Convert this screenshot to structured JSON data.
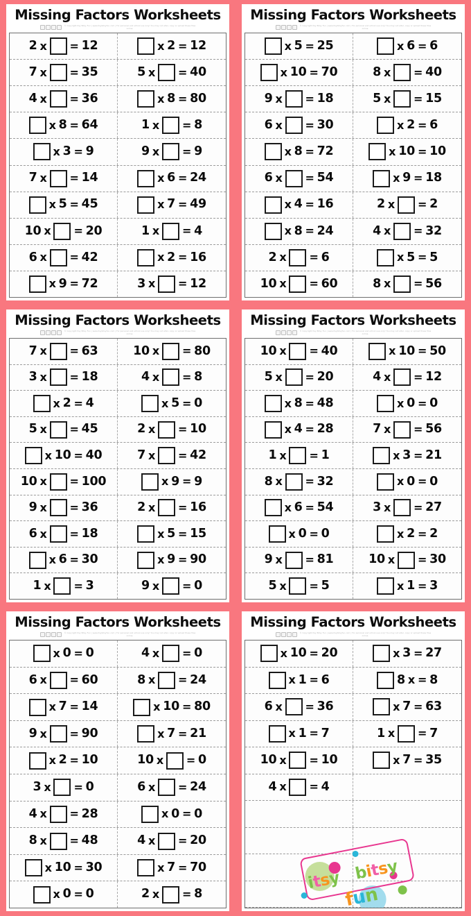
{
  "page": {
    "title": "Missing Factors Worksheets",
    "border_color": "#f9777f",
    "ink_color": "#0a0a0a",
    "sheet_count": 6,
    "columns_per_sheet": 2,
    "copyright_line1": "© Copyright Itsy Bitsy Fun | www.itsybitsyfun.com | For personal and school use only!",
    "copyright_line2": "You may not alter, copy or upload these files online."
  },
  "watermark": {
    "word1": "itsy",
    "word2": "bitsy",
    "word3": "fun",
    "colors": {
      "pink": "#f15fa6",
      "magenta": "#e8368f",
      "green": "#7ec24a",
      "orange": "#f7941e",
      "blue": "#29b6d8",
      "lightgreen": "#bcd98a",
      "lightblue": "#92d6ea"
    }
  },
  "worksheets": [
    {
      "id": 1,
      "title": "Missing Factors Worksheets",
      "rows": [
        {
          "left": [
            "2",
            "x",
            "BLANK",
            "=",
            "12"
          ],
          "right": [
            "BLANK",
            "x",
            "2",
            "=",
            "12"
          ]
        },
        {
          "left": [
            "7",
            "x",
            "BLANK",
            "=",
            "35"
          ],
          "right": [
            "5",
            "x",
            "BLANK",
            "=",
            "40"
          ]
        },
        {
          "left": [
            "4",
            "x",
            "BLANK",
            "=",
            "36"
          ],
          "right": [
            "BLANK",
            "x",
            "8",
            "=",
            "80"
          ]
        },
        {
          "left": [
            "BLANK",
            "x",
            "8",
            "=",
            "64"
          ],
          "right": [
            "1",
            "x",
            "BLANK",
            "=",
            "8"
          ]
        },
        {
          "left": [
            "BLANK",
            "x",
            "3",
            "=",
            "9"
          ],
          "right": [
            "9",
            "x",
            "BLANK",
            "=",
            "9"
          ]
        },
        {
          "left": [
            "7",
            "x",
            "BLANK",
            "=",
            "14"
          ],
          "right": [
            "BLANK",
            "x",
            "6",
            "=",
            "24"
          ]
        },
        {
          "left": [
            "BLANK",
            "x",
            "5",
            "=",
            "45"
          ],
          "right": [
            "BLANK",
            "x",
            "7",
            "=",
            "49"
          ]
        },
        {
          "left": [
            "10",
            "x",
            "BLANK",
            "=",
            "20"
          ],
          "right": [
            "1",
            "x",
            "BLANK",
            "=",
            "4"
          ]
        },
        {
          "left": [
            "6",
            "x",
            "BLANK",
            "=",
            "42"
          ],
          "right": [
            "BLANK",
            "x",
            "2",
            "=",
            "16"
          ]
        },
        {
          "left": [
            "BLANK",
            "x",
            "9",
            "=",
            "72"
          ],
          "right": [
            "3",
            "x",
            "BLANK",
            "=",
            "12"
          ]
        }
      ]
    },
    {
      "id": 2,
      "title": "Missing Factors Worksheets",
      "rows": [
        {
          "left": [
            "BLANK",
            "x",
            "5",
            "=",
            "25"
          ],
          "right": [
            "BLANK",
            "x",
            "6",
            "=",
            "6"
          ]
        },
        {
          "left": [
            "BLANK",
            "x",
            "10",
            "=",
            "70"
          ],
          "right": [
            "8",
            "x",
            "BLANK",
            "=",
            "40"
          ]
        },
        {
          "left": [
            "9",
            "x",
            "BLANK",
            "=",
            "18"
          ],
          "right": [
            "5",
            "x",
            "BLANK",
            "=",
            "15"
          ]
        },
        {
          "left": [
            "6",
            "x",
            "BLANK",
            "=",
            "30"
          ],
          "right": [
            "BLANK",
            "x",
            "2",
            "=",
            "6"
          ]
        },
        {
          "left": [
            "BLANK",
            "x",
            "8",
            "=",
            "72"
          ],
          "right": [
            "BLANK",
            "x",
            "10",
            "=",
            "10"
          ]
        },
        {
          "left": [
            "6",
            "x",
            "BLANK",
            "=",
            "54"
          ],
          "right": [
            "BLANK",
            "x",
            "9",
            "=",
            "18"
          ]
        },
        {
          "left": [
            "BLANK",
            "x",
            "4",
            "=",
            "16"
          ],
          "right": [
            "2",
            "x",
            "BLANK",
            "=",
            "2"
          ]
        },
        {
          "left": [
            "BLANK",
            "x",
            "8",
            "=",
            "24"
          ],
          "right": [
            "4",
            "x",
            "BLANK",
            "=",
            "32"
          ]
        },
        {
          "left": [
            "2",
            "x",
            "BLANK",
            "=",
            "6"
          ],
          "right": [
            "BLANK",
            "x",
            "5",
            "=",
            "5"
          ]
        },
        {
          "left": [
            "10",
            "x",
            "BLANK",
            "=",
            "60"
          ],
          "right": [
            "8",
            "x",
            "BLANK",
            "=",
            "56"
          ]
        }
      ]
    },
    {
      "id": 3,
      "title": "Missing Factors Worksheets",
      "rows": [
        {
          "left": [
            "7",
            "x",
            "BLANK",
            "=",
            "63"
          ],
          "right": [
            "10",
            "x",
            "BLANK",
            "=",
            "80"
          ]
        },
        {
          "left": [
            "3",
            "x",
            "BLANK",
            "=",
            "18"
          ],
          "right": [
            "4",
            "x",
            "BLANK",
            "=",
            "8"
          ]
        },
        {
          "left": [
            "BLANK",
            "x",
            "2",
            "=",
            "4"
          ],
          "right": [
            "BLANK",
            "x",
            "5",
            "=",
            "0"
          ]
        },
        {
          "left": [
            "5",
            "x",
            "BLANK",
            "=",
            "45"
          ],
          "right": [
            "2",
            "x",
            "BLANK",
            "=",
            "10"
          ]
        },
        {
          "left": [
            "BLANK",
            "x",
            "10",
            "=",
            "40"
          ],
          "right": [
            "7",
            "x",
            "BLANK",
            "=",
            "42"
          ]
        },
        {
          "left": [
            "10",
            "x",
            "BLANK",
            "=",
            "100"
          ],
          "right": [
            "BLANK",
            "x",
            "9",
            "=",
            "9"
          ]
        },
        {
          "left": [
            "9",
            "x",
            "BLANK",
            "=",
            "36"
          ],
          "right": [
            "2",
            "x",
            "BLANK",
            "=",
            "16"
          ]
        },
        {
          "left": [
            "6",
            "x",
            "BLANK",
            "=",
            "18"
          ],
          "right": [
            "BLANK",
            "x",
            "5",
            "=",
            "15"
          ]
        },
        {
          "left": [
            "BLANK",
            "x",
            "6",
            "=",
            "30"
          ],
          "right": [
            "BLANK",
            "x",
            "9",
            "=",
            "90"
          ]
        },
        {
          "left": [
            "1",
            "x",
            "BLANK",
            "=",
            "3"
          ],
          "right": [
            "9",
            "x",
            "BLANK",
            "=",
            "0"
          ]
        }
      ]
    },
    {
      "id": 4,
      "title": "Missing Factors Worksheets",
      "rows": [
        {
          "left": [
            "10",
            "x",
            "BLANK",
            "=",
            "40"
          ],
          "right": [
            "BLANK",
            "x",
            "10",
            "=",
            "50"
          ]
        },
        {
          "left": [
            "5",
            "x",
            "BLANK",
            "=",
            "20"
          ],
          "right": [
            "4",
            "x",
            "BLANK",
            "=",
            "12"
          ]
        },
        {
          "left": [
            "BLANK",
            "x",
            "8",
            "=",
            "48"
          ],
          "right": [
            "BLANK",
            "x",
            "0",
            "=",
            "0"
          ]
        },
        {
          "left": [
            "BLANK",
            "x",
            "4",
            "=",
            "28"
          ],
          "right": [
            "7",
            "x",
            "BLANK",
            "=",
            "56"
          ]
        },
        {
          "left": [
            "1",
            "x",
            "BLANK",
            "=",
            "1"
          ],
          "right": [
            "BLANK",
            "x",
            "3",
            "=",
            "21"
          ]
        },
        {
          "left": [
            "8",
            "x",
            "BLANK",
            "=",
            "32"
          ],
          "right": [
            "BLANK",
            "x",
            "0",
            "=",
            "0"
          ]
        },
        {
          "left": [
            "BLANK",
            "x",
            "6",
            "=",
            "54"
          ],
          "right": [
            "3",
            "x",
            "BLANK",
            "=",
            "27"
          ]
        },
        {
          "left": [
            "BLANK",
            "x",
            "0",
            "=",
            "0"
          ],
          "right": [
            "BLANK",
            "x",
            "2",
            "=",
            "2"
          ]
        },
        {
          "left": [
            "9",
            "x",
            "BLANK",
            "=",
            "81"
          ],
          "right": [
            "10",
            "x",
            "BLANK",
            "=",
            "30"
          ]
        },
        {
          "left": [
            "5",
            "x",
            "BLANK",
            "=",
            "5"
          ],
          "right": [
            "BLANK",
            "x",
            "1",
            "=",
            "3"
          ]
        }
      ]
    },
    {
      "id": 5,
      "title": "Missing Factors Worksheets",
      "rows": [
        {
          "left": [
            "BLANK",
            "x",
            "0",
            "=",
            "0"
          ],
          "right": [
            "4",
            "x",
            "BLANK",
            "=",
            "0"
          ]
        },
        {
          "left": [
            "6",
            "x",
            "BLANK",
            "=",
            "60"
          ],
          "right": [
            "8",
            "x",
            "BLANK",
            "=",
            "24"
          ]
        },
        {
          "left": [
            "BLANK",
            "x",
            "7",
            "=",
            "14"
          ],
          "right": [
            "BLANK",
            "x",
            "10",
            "=",
            "80"
          ]
        },
        {
          "left": [
            "9",
            "x",
            "BLANK",
            "=",
            "90"
          ],
          "right": [
            "BLANK",
            "x",
            "7",
            "=",
            "21"
          ]
        },
        {
          "left": [
            "BLANK",
            "x",
            "2",
            "=",
            "10"
          ],
          "right": [
            "10",
            "x",
            "BLANK",
            "=",
            "0"
          ]
        },
        {
          "left": [
            "3",
            "x",
            "BLANK",
            "=",
            "0"
          ],
          "right": [
            "6",
            "x",
            "BLANK",
            "=",
            "24"
          ]
        },
        {
          "left": [
            "4",
            "x",
            "BLANK",
            "=",
            "28"
          ],
          "right": [
            "BLANK",
            "x",
            "0",
            "=",
            "0"
          ]
        },
        {
          "left": [
            "8",
            "x",
            "BLANK",
            "=",
            "48"
          ],
          "right": [
            "4",
            "x",
            "BLANK",
            "=",
            "20"
          ]
        },
        {
          "left": [
            "BLANK",
            "x",
            "10",
            "=",
            "30"
          ],
          "right": [
            "BLANK",
            "x",
            "7",
            "=",
            "70"
          ]
        },
        {
          "left": [
            "BLANK",
            "x",
            "0",
            "=",
            "0"
          ],
          "right": [
            "2",
            "x",
            "BLANK",
            "=",
            "8"
          ]
        }
      ]
    },
    {
      "id": 6,
      "title": "Missing Factors Worksheets",
      "has_watermark": true,
      "rows": [
        {
          "left": [
            "BLANK",
            "x",
            "10",
            "=",
            "20"
          ],
          "right": [
            "BLANK",
            "x",
            "3",
            "=",
            "27"
          ]
        },
        {
          "left": [
            "BLANK",
            "x",
            "1",
            "=",
            "6"
          ],
          "right": [
            "BLANK",
            "8",
            "x",
            "=",
            "8"
          ]
        },
        {
          "left": [
            "6",
            "x",
            "BLANK",
            "=",
            "36"
          ],
          "right": [
            "BLANK",
            "x",
            "7",
            "=",
            "63"
          ]
        },
        {
          "left": [
            "BLANK",
            "x",
            "1",
            "=",
            "7"
          ],
          "right": [
            "1",
            "x",
            "BLANK",
            "=",
            "7"
          ]
        },
        {
          "left": [
            "10",
            "x",
            "BLANK",
            "=",
            "10"
          ],
          "right": [
            "BLANK",
            "x",
            "7",
            "=",
            "35"
          ]
        },
        {
          "left": [
            "4",
            "x",
            "BLANK",
            "=",
            "4"
          ],
          "right": []
        },
        {
          "left": [],
          "right": []
        },
        {
          "left": [],
          "right": []
        },
        {
          "left": [],
          "right": []
        },
        {
          "left": [],
          "right": []
        }
      ]
    }
  ]
}
